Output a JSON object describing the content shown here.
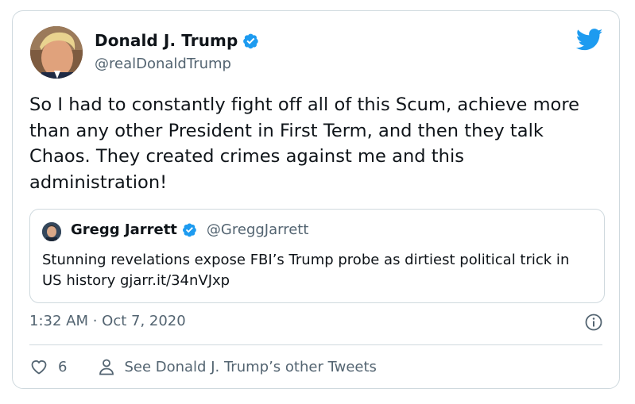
{
  "tweet": {
    "author_name": "Donald J. Trump",
    "author_handle": "@realDonaldTrump",
    "verified": true,
    "text": "So I had to constantly fight off all of this Scum, achieve more than any other President in First Term, and then they talk Chaos. They created crimes against me and this administration!",
    "timestamp": "1:32 AM · Oct 7, 2020",
    "like_count": "6",
    "other_tweets_label": "See Donald J. Trump’s other Tweets"
  },
  "quoted_tweet": {
    "author_name": "Gregg Jarrett",
    "author_handle": "@GreggJarrett",
    "verified": true,
    "text": "Stunning revelations expose FBI’s Trump probe as dirtiest political trick in US history gjarr.it/34nVJxp"
  },
  "icons": {
    "brand": "twitter-bird-icon",
    "verified": "verified-badge-icon",
    "info": "info-icon",
    "like": "heart-icon",
    "profile": "person-icon"
  },
  "colors": {
    "brand_blue": "#1d9bf0",
    "text_primary": "#0f1419",
    "text_secondary": "#536471",
    "border": "#cfd9de"
  }
}
